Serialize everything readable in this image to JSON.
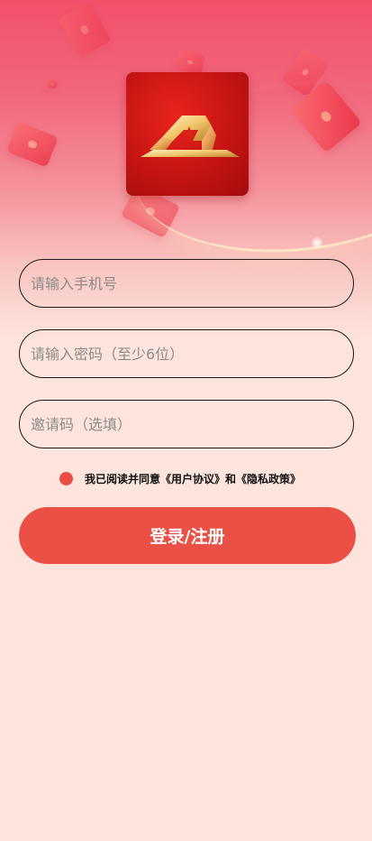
{
  "logo": {
    "icon": "gold-star-mountain-logo"
  },
  "form": {
    "phone_placeholder": "请输入手机号",
    "password_placeholder": "请输入密码（至少6位）",
    "invite_placeholder": "邀请码（选填）",
    "agreement_prefix": "我已阅读并同意",
    "user_agreement": "《用户协议》",
    "agreement_and": "和",
    "privacy_policy": "《隐私政策》",
    "agreement_checked": true,
    "submit_label": "登录/注册"
  },
  "colors": {
    "accent": "#ea5046",
    "radio": "#ea4c46",
    "page_background": "#fde5dd",
    "hero_top": "#f2506a"
  }
}
